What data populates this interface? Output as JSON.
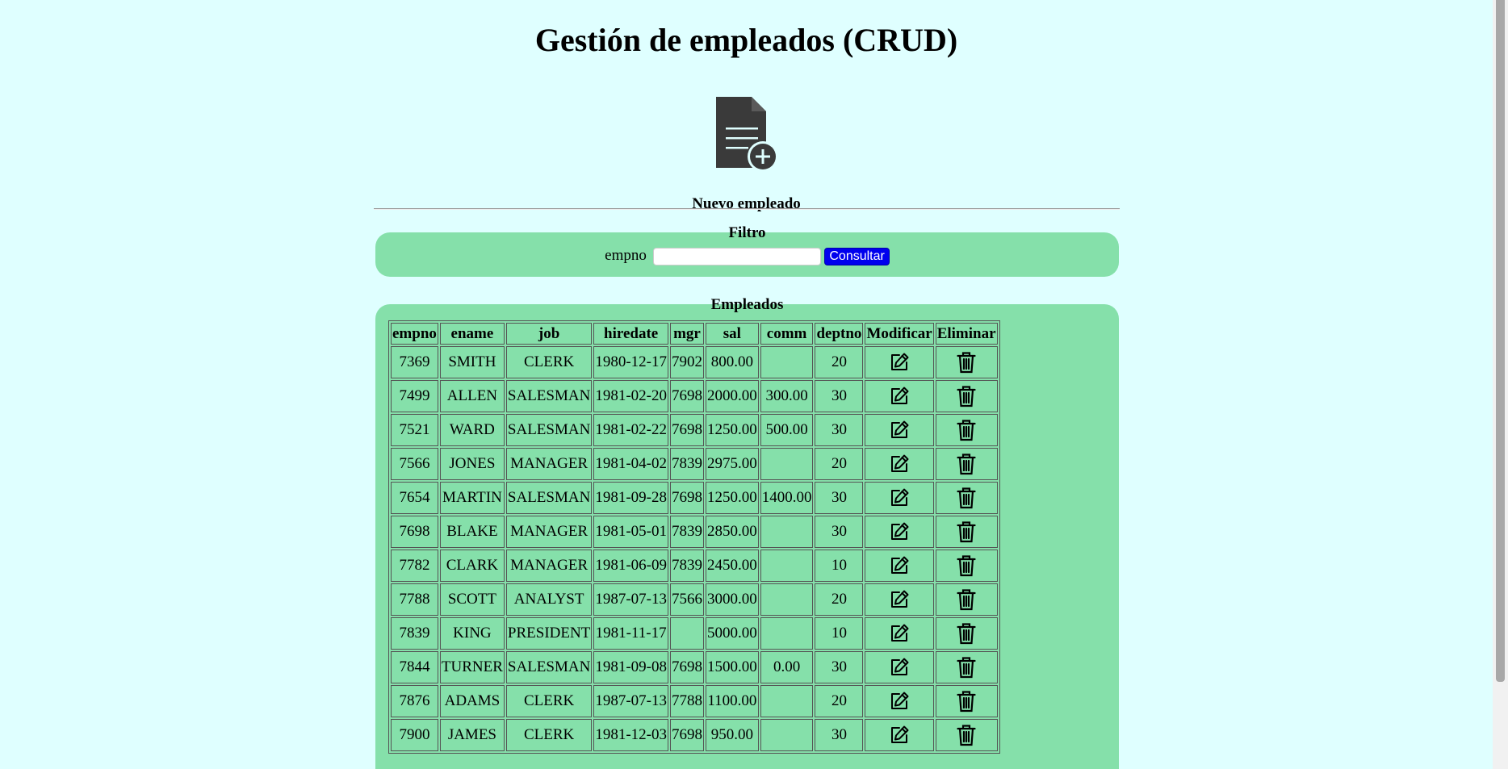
{
  "page": {
    "title": "Gestión de empleados (CRUD)",
    "new_employee_label": "Nuevo empleado"
  },
  "filter": {
    "title": "Filtro",
    "field_label": "empno",
    "field_value": "",
    "submit_label": "Consultar"
  },
  "employees": {
    "title": "Empleados",
    "columns": [
      "empno",
      "ename",
      "job",
      "hiredate",
      "mgr",
      "sal",
      "comm",
      "deptno",
      "Modificar",
      "Eliminar"
    ],
    "rows": [
      [
        "7369",
        "SMITH",
        "CLERK",
        "1980-12-17",
        "7902",
        "800.00",
        "",
        "20"
      ],
      [
        "7499",
        "ALLEN",
        "SALESMAN",
        "1981-02-20",
        "7698",
        "2000.00",
        "300.00",
        "30"
      ],
      [
        "7521",
        "WARD",
        "SALESMAN",
        "1981-02-22",
        "7698",
        "1250.00",
        "500.00",
        "30"
      ],
      [
        "7566",
        "JONES",
        "MANAGER",
        "1981-04-02",
        "7839",
        "2975.00",
        "",
        "20"
      ],
      [
        "7654",
        "MARTIN",
        "SALESMAN",
        "1981-09-28",
        "7698",
        "1250.00",
        "1400.00",
        "30"
      ],
      [
        "7698",
        "BLAKE",
        "MANAGER",
        "1981-05-01",
        "7839",
        "2850.00",
        "",
        "30"
      ],
      [
        "7782",
        "CLARK",
        "MANAGER",
        "1981-06-09",
        "7839",
        "2450.00",
        "",
        "10"
      ],
      [
        "7788",
        "SCOTT",
        "ANALYST",
        "1987-07-13",
        "7566",
        "3000.00",
        "",
        "20"
      ],
      [
        "7839",
        "KING",
        "PRESIDENT",
        "1981-11-17",
        "",
        "5000.00",
        "",
        "10"
      ],
      [
        "7844",
        "TURNER",
        "SALESMAN",
        "1981-09-08",
        "7698",
        "1500.00",
        "0.00",
        "30"
      ],
      [
        "7876",
        "ADAMS",
        "CLERK",
        "1987-07-13",
        "7788",
        "1100.00",
        "",
        "20"
      ],
      [
        "7900",
        "JAMES",
        "CLERK",
        "1981-12-03",
        "7698",
        "950.00",
        "",
        "30"
      ]
    ],
    "row_actions": {
      "edit_icon": "pencil-square-icon",
      "delete_icon": "trash-icon"
    }
  },
  "colors": {
    "page_background": "#dfffff",
    "panel_background": "#85e0aa",
    "button_background": "#0000ee",
    "icon_dark": "#3a3a3a"
  }
}
